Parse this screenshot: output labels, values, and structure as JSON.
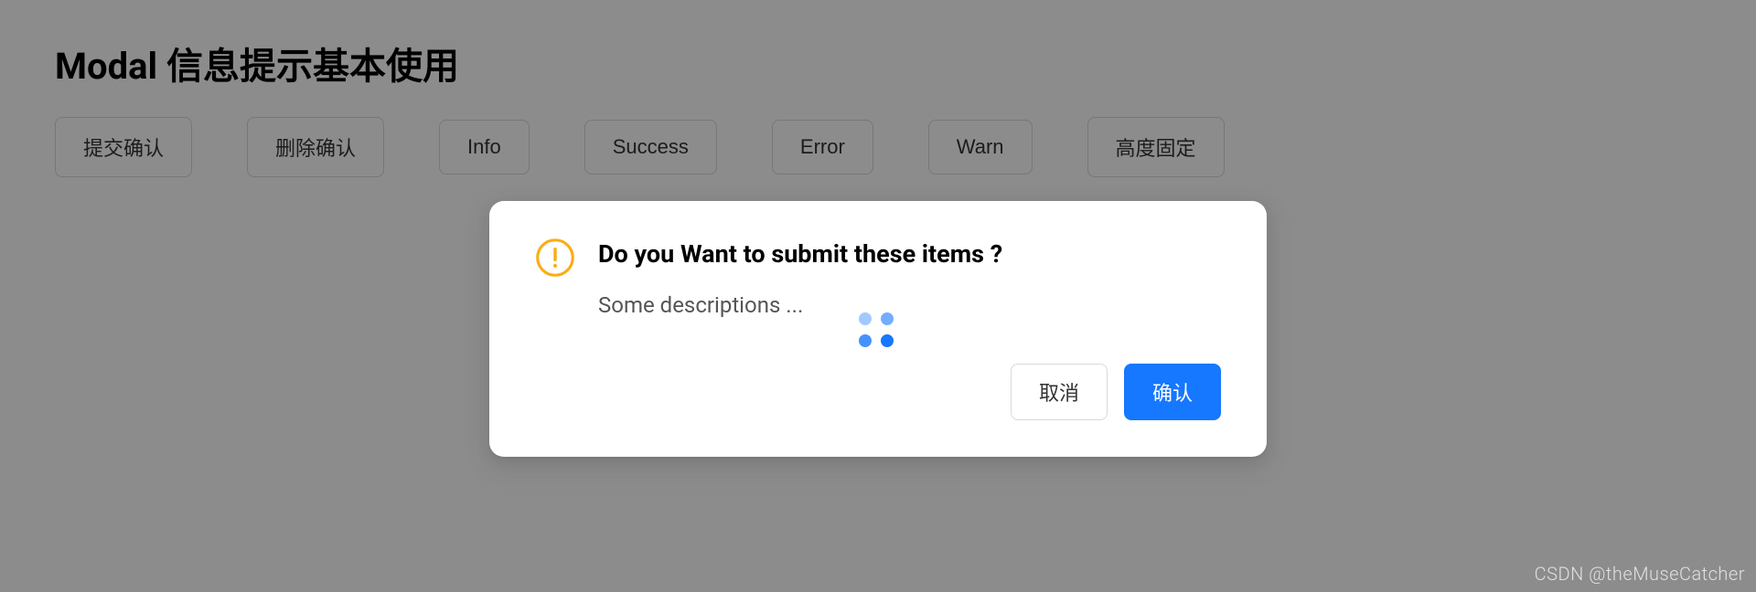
{
  "page": {
    "title": "Modal 信息提示基本使用"
  },
  "buttons": {
    "submit_confirm": "提交确认",
    "delete_confirm": "删除确认",
    "info": "Info",
    "success": "Success",
    "error": "Error",
    "warn": "Warn",
    "fixed_height": "高度固定"
  },
  "modal": {
    "title": "Do you Want to submit these items ?",
    "description": "Some descriptions ...",
    "cancel_label": "取消",
    "ok_label": "确认",
    "icon_color": "#faad14",
    "loading": true
  },
  "watermark": "CSDN @theMuseCatcher"
}
